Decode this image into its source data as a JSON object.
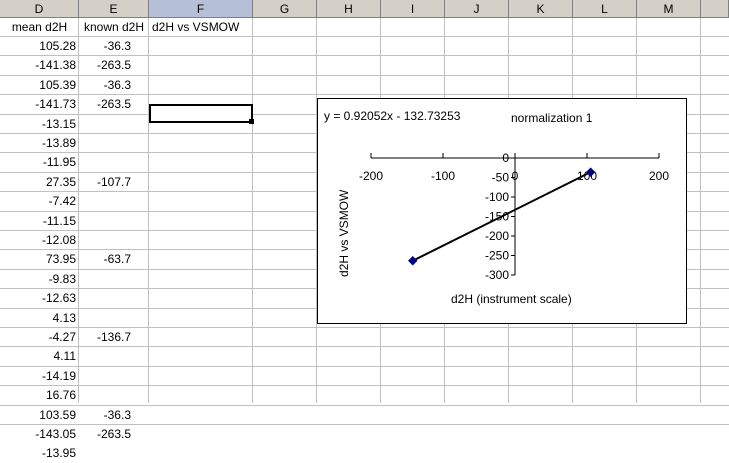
{
  "columns": [
    {
      "label": "D",
      "selected": false
    },
    {
      "label": "E",
      "selected": false
    },
    {
      "label": "F",
      "selected": true
    },
    {
      "label": "G",
      "selected": false
    },
    {
      "label": "H",
      "selected": false
    },
    {
      "label": "I",
      "selected": false
    },
    {
      "label": "J",
      "selected": false
    },
    {
      "label": "K",
      "selected": false
    },
    {
      "label": "L",
      "selected": false
    },
    {
      "label": "M",
      "selected": false
    }
  ],
  "headers": {
    "d": "mean d2H",
    "e": "known d2H",
    "f": "d2H vs VSMOW"
  },
  "rows": [
    {
      "d": "105.28",
      "e": "-36.3"
    },
    {
      "d": "-141.38",
      "e": "-263.5"
    },
    {
      "d": "105.39",
      "e": "-36.3"
    },
    {
      "d": "-141.73",
      "e": "-263.5"
    },
    {
      "d": "-13.15",
      "e": ""
    },
    {
      "d": "-13.89",
      "e": ""
    },
    {
      "d": "-11.95",
      "e": ""
    },
    {
      "d": "27.35",
      "e": "-107.7"
    },
    {
      "d": "-7.42",
      "e": ""
    },
    {
      "d": "-11.15",
      "e": ""
    },
    {
      "d": "-12.08",
      "e": ""
    },
    {
      "d": "73.95",
      "e": "-63.7"
    },
    {
      "d": "-9.83",
      "e": ""
    },
    {
      "d": "-12.63",
      "e": ""
    },
    {
      "d": "4.13",
      "e": ""
    },
    {
      "d": "-4.27",
      "e": "-136.7"
    },
    {
      "d": "4.11",
      "e": ""
    },
    {
      "d": "-14.19",
      "e": ""
    },
    {
      "d": "16.76",
      "e": ""
    },
    {
      "d": "103.59",
      "e": "-36.3"
    },
    {
      "d": "-143.05",
      "e": "-263.5"
    },
    {
      "d": "-13.95",
      "e": ""
    }
  ],
  "chart_data": {
    "type": "line",
    "title": "normalization 1",
    "equation": "y = 0.92052x - 132.73253",
    "xlabel": "d2H (instrument scale)",
    "ylabel": "d2H vs VSMOW",
    "xlim": [
      -200,
      200
    ],
    "ylim": [
      -300,
      0
    ],
    "x_ticks": [
      "-200",
      "-100",
      "0",
      "100",
      "200"
    ],
    "y_ticks": [
      "0",
      "-50",
      "-100",
      "-150",
      "-200",
      "-250",
      "-300"
    ],
    "x_tick_values": [
      -200,
      -100,
      0,
      100,
      200
    ],
    "y_tick_values": [
      0,
      -50,
      -100,
      -150,
      -200,
      -250,
      -300
    ],
    "grid": false,
    "series": [
      {
        "x": [
          -142,
          105
        ],
        "y": [
          -263.5,
          -36.3
        ],
        "color": "#000080"
      }
    ],
    "trendline": {
      "x": [
        -142,
        105
      ],
      "y": [
        -263.5,
        -36.3
      ],
      "color": "#000000"
    }
  }
}
